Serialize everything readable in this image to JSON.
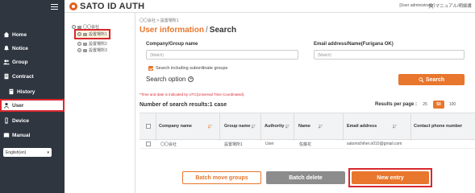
{
  "header": {
    "logo_text": "SATO ID AUTH",
    "user_label": "[User administrator]",
    "manual_label": "マニュアル/明細書"
  },
  "sidebar": {
    "items": [
      {
        "label": "Home",
        "icon": "home-icon"
      },
      {
        "label": "Notice",
        "icon": "bell-icon"
      },
      {
        "label": "Group",
        "icon": "group-icon"
      },
      {
        "label": "Contract",
        "icon": "contract-icon"
      },
      {
        "label": "History",
        "icon": "history-icon"
      },
      {
        "label": "User",
        "icon": "user-icon",
        "active": true
      },
      {
        "label": "Device",
        "icon": "device-icon"
      },
      {
        "label": "Manual",
        "icon": "manual-icon"
      }
    ],
    "language": "English(en)"
  },
  "tree": {
    "root": "〇〇会社",
    "children": [
      "設置場所1",
      "設置場所2",
      "設置場所3"
    ]
  },
  "main": {
    "breadcrumb": "〇〇会社 > 設置場所1",
    "title_part1": "User information",
    "title_sep": "/",
    "title_part2": "Search",
    "company_label": "Company/Group name",
    "company_placeholder": "(Match)",
    "email_label": "Email address/Name(Furigana OK)",
    "email_placeholder": "(Match)",
    "include_subordinate": "Search including subordinate groups",
    "search_option": "Search option",
    "search_button": "Search",
    "note": "*Time and date is indicated by UTC(Universal Time Coordinated).",
    "result_count": "Number of search results:1 case",
    "per_page_label": "Results per page :",
    "per_page_options": [
      "25",
      "50",
      "100"
    ],
    "per_page_selected": "50"
  },
  "table": {
    "columns": [
      "Company name",
      "Group name",
      "Authority",
      "Name",
      "Email address",
      "Contact phone number"
    ],
    "rows": [
      [
        "〇〇会社",
        "設置場所1",
        "User",
        "佐藤花",
        "satomichiher.o010@gmail.com",
        ""
      ]
    ]
  },
  "actions": {
    "batch_move": "Batch move groups",
    "batch_delete": "Batch delete",
    "new_entry": "New entry"
  },
  "colors": {
    "accent": "#e8762c",
    "highlight": "#d9282f",
    "sidebar_bg": "#2f3640"
  }
}
